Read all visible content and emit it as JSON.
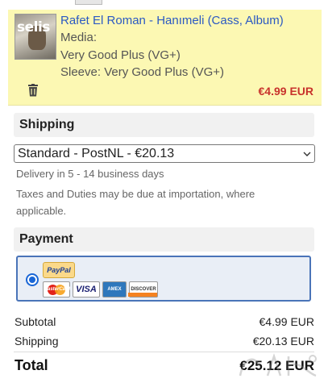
{
  "item": {
    "cover_text": "selis",
    "title": "Rafet El Roman - Hanımeli (Cass, Album)",
    "media_label": "Media:",
    "media_condition": "Very Good Plus (VG+)",
    "sleeve": "Sleeve: Very Good Plus (VG+)",
    "price": "€4.99 EUR"
  },
  "shipping": {
    "heading": "Shipping",
    "selected_option": "Standard - PostNL - €20.13",
    "delivery_note": "Delivery in 5 - 14 business days",
    "tax_note_line1": "Taxes and Duties may be due at importation, where",
    "tax_note_line2": "applicable."
  },
  "payment": {
    "heading": "Payment",
    "methods": {
      "paypal": "PayPal",
      "mastercard": "MasterCard",
      "visa": "VISA",
      "amex": "AMEX",
      "discover": "DISCOVER"
    }
  },
  "summary": {
    "subtotal_label": "Subtotal",
    "subtotal_value": "€4.99 EUR",
    "shipping_label": "Shipping",
    "shipping_value": "€20.13 EUR",
    "total_label": "Total",
    "total_value": "€25.12 EUR"
  },
  "colors": {
    "item_bg": "#fcf8b3",
    "link": "#2b59c3",
    "price": "#c8322c",
    "accent": "#4a74b8"
  }
}
